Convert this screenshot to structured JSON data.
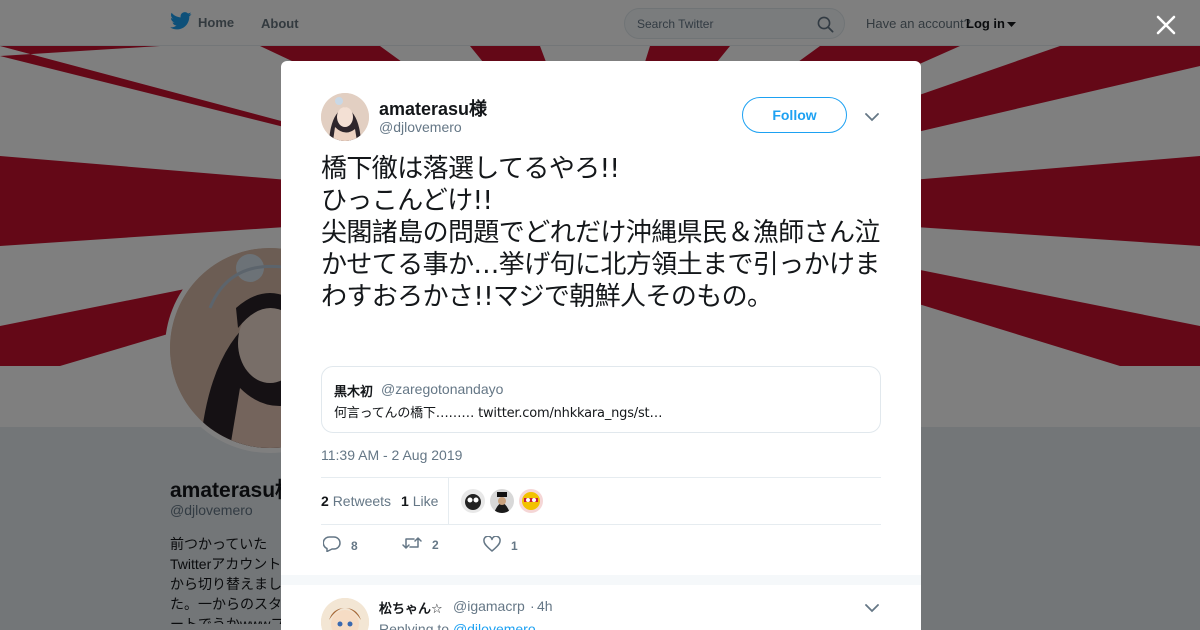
{
  "topbar": {
    "home_label": "Home",
    "about_label": "About",
    "search_placeholder": "Search Twitter",
    "account_prompt": "Have an account?",
    "login_label": "Log in"
  },
  "profile": {
    "name": "amaterasu様",
    "handle": "@djlovemero",
    "bio": "前つかっていたTwitterアカウントから切り替えました。一からのスタートでうかwwwフォロワーの皆様、またフォロお願いい"
  },
  "tweet": {
    "author_name": "amaterasu様",
    "author_handle": "@djlovemero",
    "follow_label": "Follow",
    "text": "橋下徹は落選してるやろ!!\nひっこんどけ!!\n尖閣諸島の問題でどれだけ沖縄県民＆漁師さん泣かせてる事か…挙げ句に北方領土まで引っかけまわすおろかさ!!マジで朝鮮人そのもの。",
    "quote": {
      "name": "黒木初",
      "handle": "@zaregotonandayo",
      "text": "何言ってんの橋下……… twitter.com/nhkkara_ngs/st…"
    },
    "timestamp": "11:39 AM - 2 Aug 2019",
    "retweets_count": "2",
    "retweets_label": "Retweets",
    "likes_count": "1",
    "likes_label": "Like",
    "reply_action_count": "8",
    "retweet_action_count": "2",
    "like_action_count": "1"
  },
  "reply": {
    "name": "松ちゃん☆",
    "handle": "@igamacrp",
    "dot": "·",
    "time": "4h",
    "replying_prefix": "Replying to",
    "replying_to": "@djlovemero"
  },
  "colors": {
    "brand": "#1da1f2",
    "flag_red": "#c8102e",
    "text": "#14171a",
    "muted": "#657786"
  },
  "icons": [
    "twitter-bird-icon",
    "home-icon",
    "search-icon",
    "caret-down-icon",
    "close-icon",
    "reply-icon",
    "retweet-icon",
    "heart-icon",
    "chevron-down-icon"
  ]
}
